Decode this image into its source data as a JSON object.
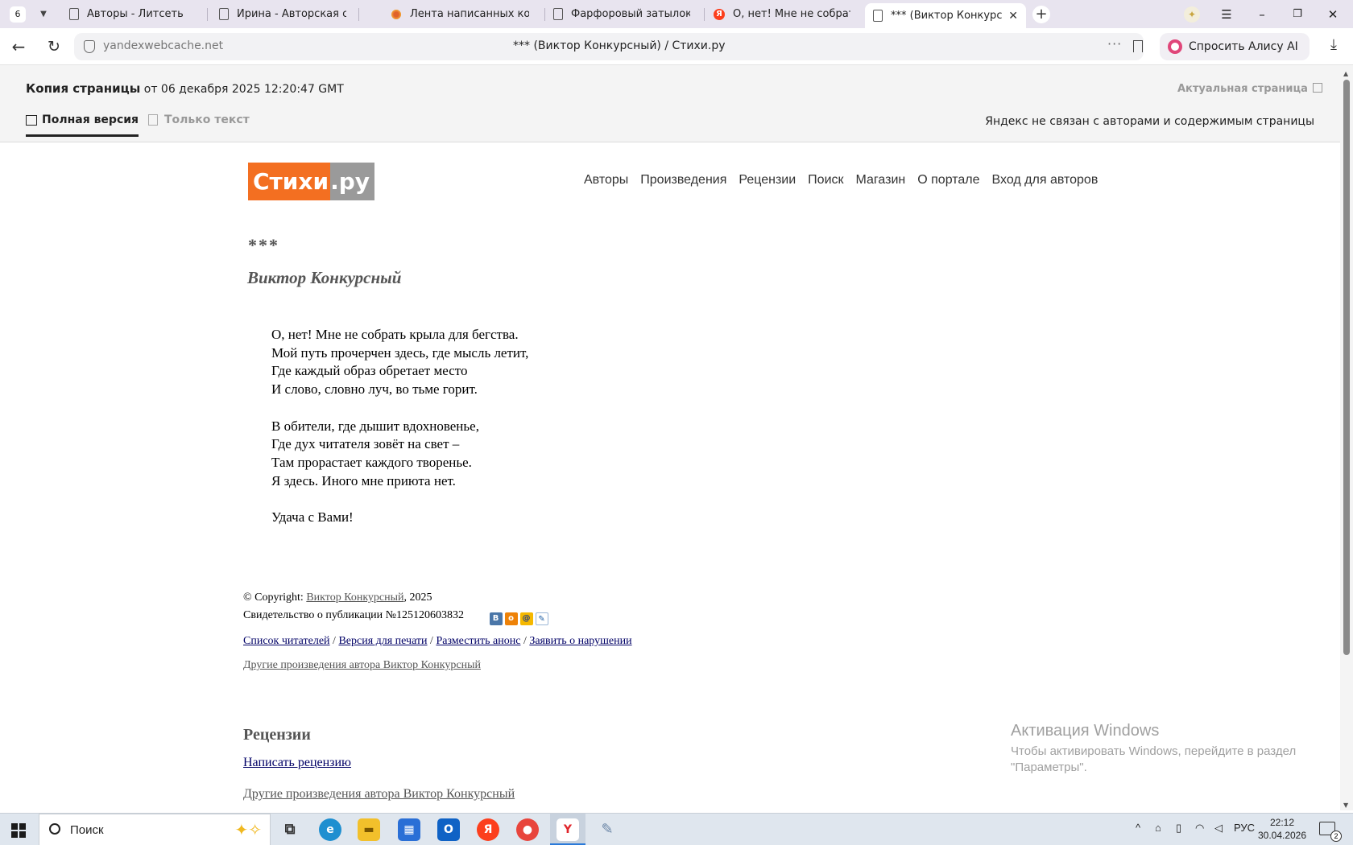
{
  "browser": {
    "tab_count": "6",
    "tabs": [
      {
        "title": "Авторы - Литсеть"
      },
      {
        "title": "Ирина - Авторская стран"
      },
      {
        "title": "Лента написанных комме"
      },
      {
        "title": "Фарфоровый затылок де"
      },
      {
        "title": "О, нет! Мне не собрать кр"
      },
      {
        "title": "*** (Виктор Конкурсны"
      }
    ],
    "url_host": "yandexwebcache.net",
    "url_title": "*** (Виктор Конкурсный) / Стихи.ру",
    "alice_button": "Спросить Алису AI",
    "more_dots": "···"
  },
  "cache_banner": {
    "copy_label": "Копия страницы",
    "copy_date": " от 06 декабря 2025 12:20:47 GMT",
    "current_page_link": "Актуальная страница",
    "tab_full": "Полная версия",
    "tab_text": "Только текст",
    "disclaimer": "Яндекс не связан с авторами и содержимым страницы"
  },
  "site": {
    "logo_part1": "Стихи",
    "logo_part2": ".ру",
    "nav": [
      "Авторы",
      "Произведения",
      "Рецензии",
      "Поиск",
      "Магазин",
      "О портале",
      "Вход для авторов"
    ]
  },
  "poem": {
    "title": "***",
    "author": "Виктор Конкурсный",
    "stanzas": [
      [
        "О, нет! Мне не собрать крыла для бегства.",
        "Мой путь прочерчен здесь, где мысль летит,",
        "Где каждый образ обретает место",
        "И слово, словно луч, во тьме горит."
      ],
      [
        "В обители, где дышит вдохновенье,",
        "Где дух читателя зовёт на свет –",
        "Там прорастает каждого творенье.",
        "Я здесь. Иного мне приюта нет."
      ],
      [
        "Удача с Вами!"
      ]
    ]
  },
  "footer": {
    "copyright_prefix": "© Copyright: ",
    "copyright_author": "Виктор Конкурсный",
    "copyright_year": ", 2025",
    "certificate": "Свидетельство о публикации №125120603832",
    "share_icons": [
      "vk-icon",
      "odnoklassniki-icon",
      "mail-icon",
      "livejournal-icon"
    ],
    "links": [
      "Список читателей",
      "Версия для печати",
      "Разместить анонс",
      "Заявить о нарушении"
    ],
    "separator": " / ",
    "other_works": "Другие произведения автора Виктор Конкурсный",
    "reviews_heading": "Рецензии",
    "write_review": "Написать рецензию",
    "other_works_2": "Другие произведения автора Виктор Конкурсный"
  },
  "windows_activation": {
    "title": "Активация Windows",
    "subtitle": "Чтобы активировать Windows, перейдите в раздел \"Параметры\"."
  },
  "taskbar": {
    "search_placeholder": "Поиск",
    "tray_lang": "РУС",
    "time": "22:12",
    "date": "30.04.2026",
    "notifications": "2"
  },
  "colors": {
    "logo_orange": "#f36f21",
    "logo_gray": "#9a9a9a",
    "link": "#000066",
    "tab_strip": "#e8e4ef"
  }
}
